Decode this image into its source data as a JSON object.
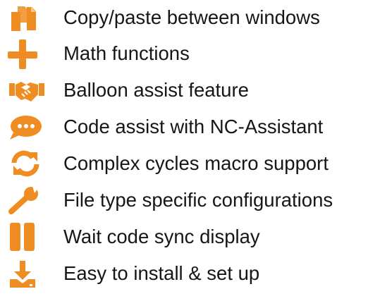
{
  "accent_color": "#EF8D22",
  "text_color": "#161616",
  "features": [
    {
      "icon": "copy-paste-icon",
      "label": "Copy/paste between windows"
    },
    {
      "icon": "plus-icon",
      "label": "Math functions"
    },
    {
      "icon": "handshake-icon",
      "label": "Balloon assist feature"
    },
    {
      "icon": "chat-bubble-icon",
      "label": "Code assist with NC-Assistant"
    },
    {
      "icon": "refresh-icon",
      "label": "Complex cycles macro support"
    },
    {
      "icon": "wrench-icon",
      "label": "File type specific configurations"
    },
    {
      "icon": "pause-icon",
      "label": "Wait code sync display"
    },
    {
      "icon": "download-icon",
      "label": "Easy to install & set up"
    }
  ]
}
